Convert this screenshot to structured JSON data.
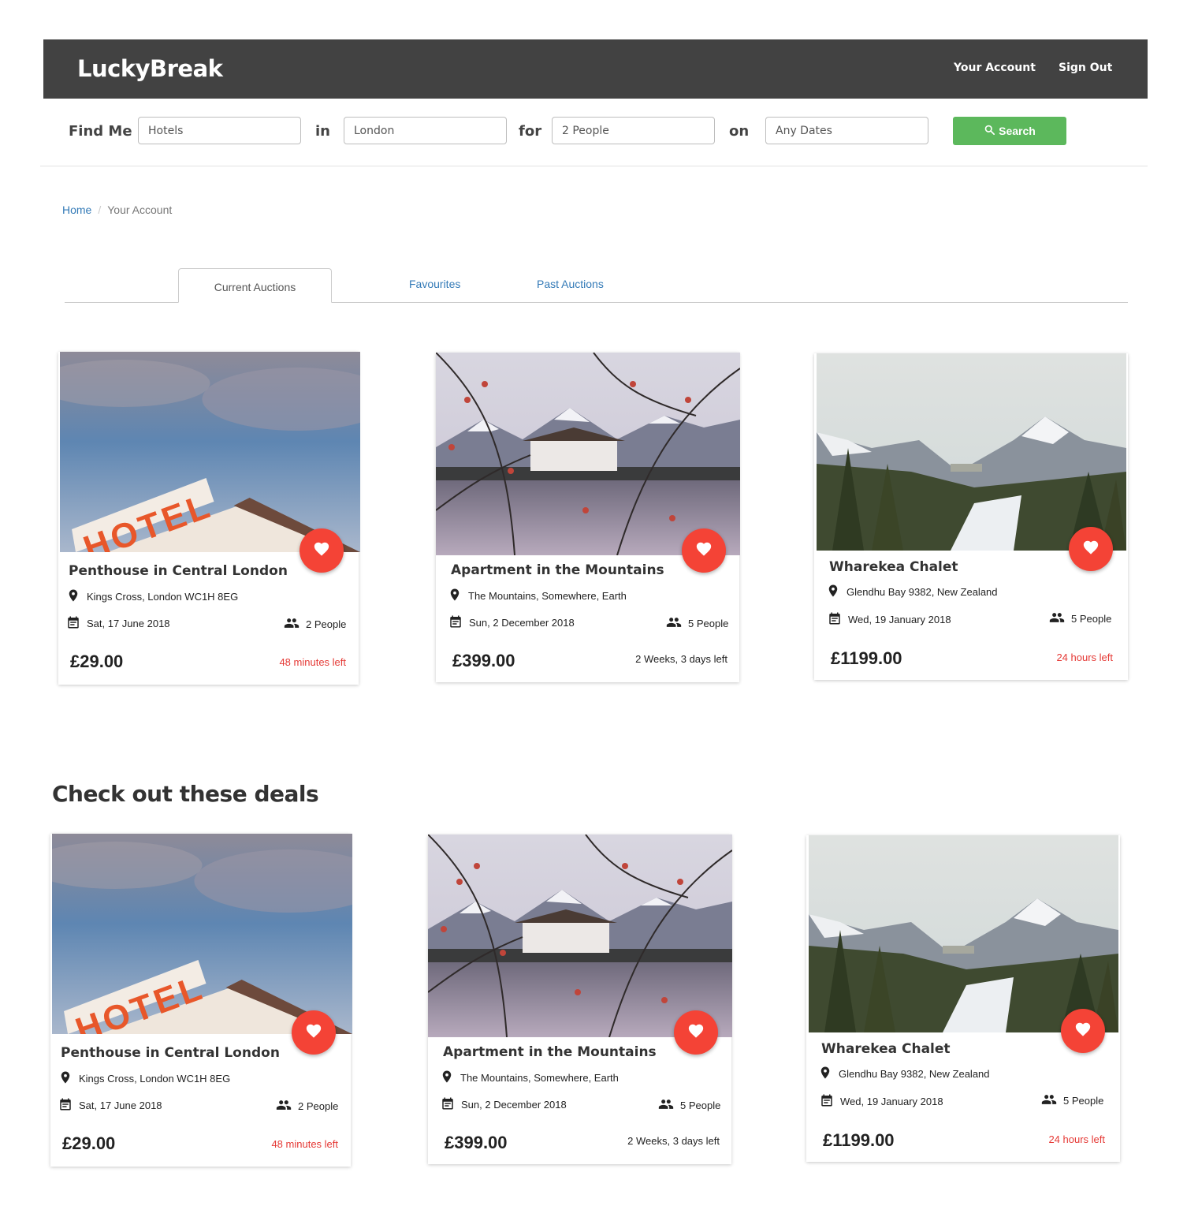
{
  "header": {
    "logo": "LuckyBreak",
    "nav": [
      "Your Account",
      "Sign Out"
    ]
  },
  "search": {
    "label_find": "Find Me",
    "label_in": "in",
    "label_for": "for",
    "label_on": "on",
    "type_value": "Hotels",
    "location_value": "London",
    "people_value": "2 People",
    "dates_value": "Any Dates",
    "button_label": "Search"
  },
  "breadcrumb": {
    "home": "Home",
    "current": "Your Account"
  },
  "tabs": {
    "current": "Current Auctions",
    "favourites": "Favourites",
    "past": "Past Auctions"
  },
  "deals_title": "Check out these deals",
  "listings": [
    {
      "title": "Penthouse in Central London",
      "address": "Kings Cross, London WC1H 8EG",
      "date": "Sat, 17 June 2018",
      "people": "2 People",
      "price": "£29.00",
      "time_left": "48 minutes left",
      "urgent": true,
      "image": "hotel-sign-photo"
    },
    {
      "title": "Apartment in the Mountains",
      "address": "The Mountains, Somewhere, Earth",
      "date": "Sun, 2 December 2018",
      "people": "5 People",
      "price": "£399.00",
      "time_left": "2 Weeks, 3 days left",
      "urgent": false,
      "image": "lake-chalet-photo"
    },
    {
      "title": "Wharekea Chalet",
      "address": "Glendhu Bay 9382, New Zealand",
      "date": "Wed, 19 January 2018",
      "people": "5 People",
      "price": "£1199.00",
      "time_left": "24 hours left",
      "urgent": true,
      "image": "mountain-forest-photo"
    }
  ],
  "colors": {
    "header_bg": "#424242",
    "search_button": "#5cb85c",
    "favourite_button": "#f44336",
    "link": "#337ab7",
    "urgent_text": "#e53935"
  }
}
